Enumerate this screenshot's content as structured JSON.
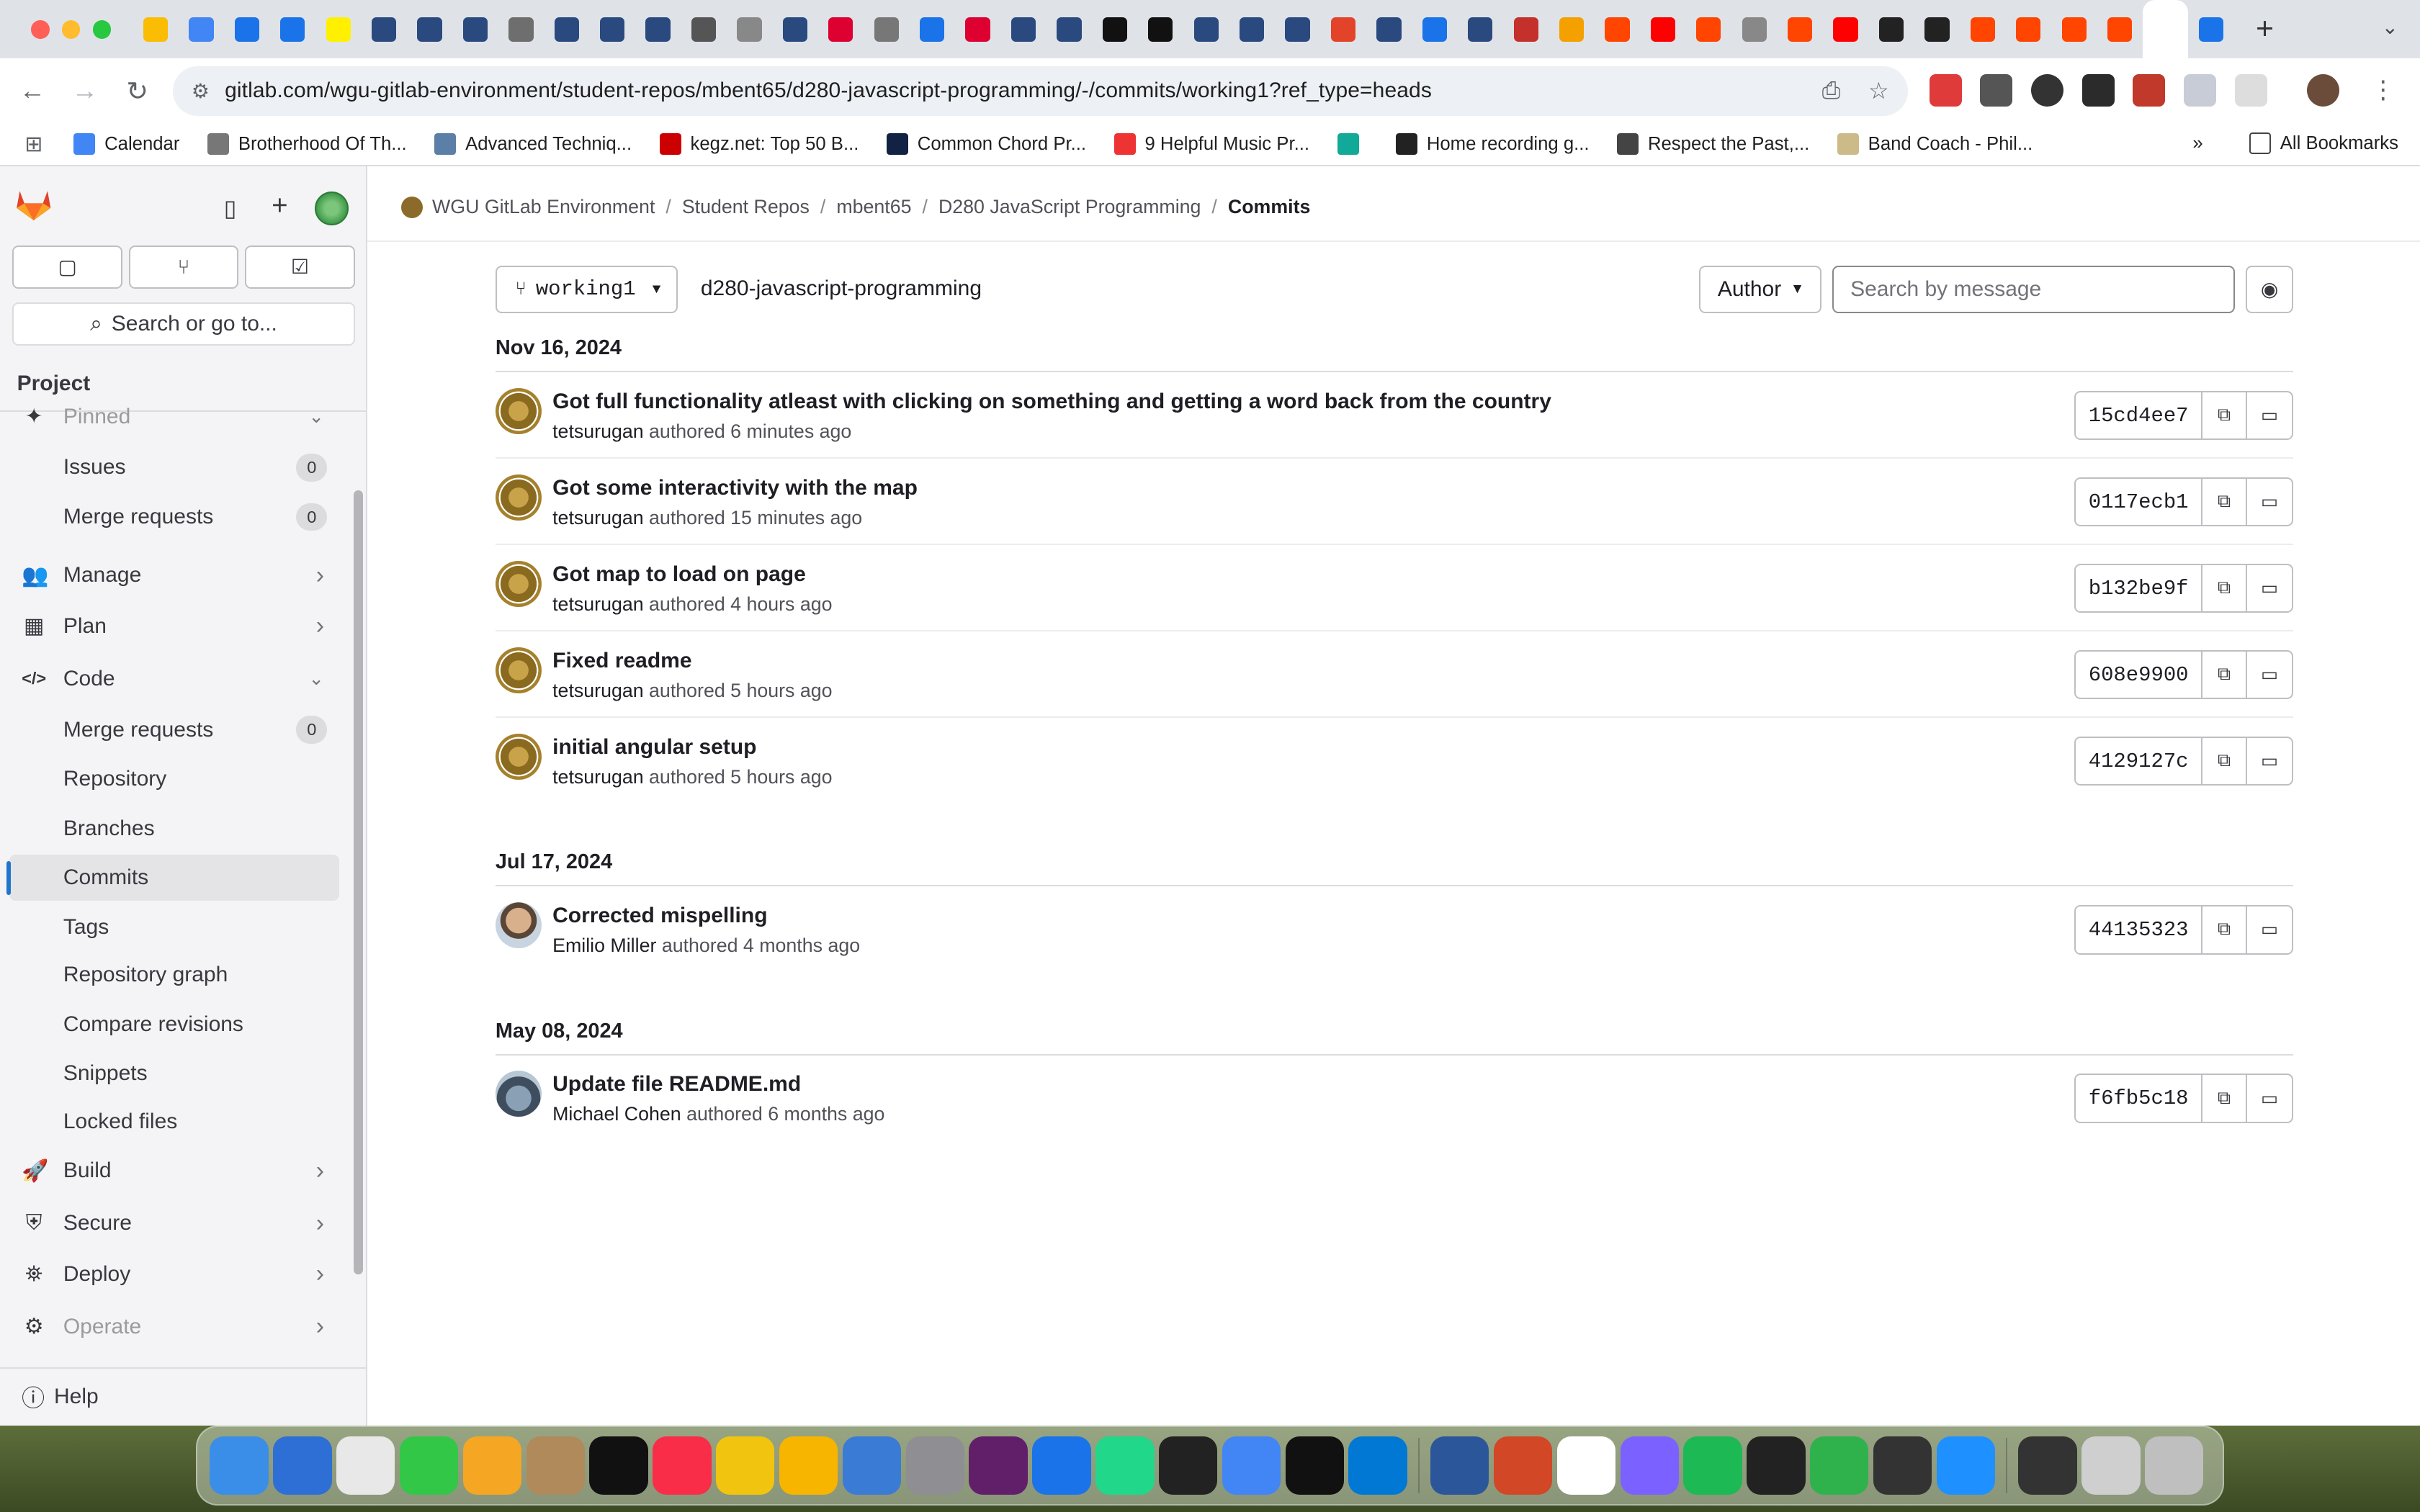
{
  "browser": {
    "url": "gitlab.com/wgu-gitlab-environment/student-repos/mbent65/d280-javascript-programming/-/commits/working1?ref_type=heads",
    "tab_favicon_colors": [
      "#fbbc04",
      "#4285f4",
      "#1a73e8",
      "#1a73e8",
      "#fef000",
      "#2a4a7f",
      "#2a4a7f",
      "#2a4a7f",
      "#6e6e6e",
      "#2a4a7f",
      "#2a4a7f",
      "#2a4a7f",
      "#555",
      "#888",
      "#2a4a7f",
      "#dd0031",
      "#777",
      "#1a73e8",
      "#dd0031",
      "#2a4a7f",
      "#2a4a7f",
      "#111",
      "#111",
      "#2a4a7f",
      "#2a4a7f",
      "#2a4a7f",
      "#e24329",
      "#2a4a7f",
      "#1a73e8",
      "#2a4a7f",
      "#c4302b",
      "#f4a100",
      "#ff4500",
      "#ff0000",
      "#ff4500",
      "#888",
      "#ff4500",
      "#ff0000",
      "#222",
      "#222",
      "#ff4500",
      "#ff4500",
      "#ff4500",
      "#ff4500",
      "#fff",
      "#1a73e8"
    ],
    "bookmarks": [
      {
        "label": "Calendar",
        "color": "#4285f4"
      },
      {
        "label": "Brotherhood Of Th...",
        "color": "#777"
      },
      {
        "label": "Advanced Techniq...",
        "color": "#5b7fa6"
      },
      {
        "label": "kegz.net: Top 50 B...",
        "color": "#c00"
      },
      {
        "label": "Common Chord Pr...",
        "color": "#124"
      },
      {
        "label": "9 Helpful Music Pr...",
        "color": "#e33"
      },
      {
        "label": "",
        "color": "#1a9"
      },
      {
        "label": "Home recording g...",
        "color": "#222"
      },
      {
        "label": "Respect the Past,...",
        "color": "#444"
      },
      {
        "label": "Band Coach - Phil...",
        "color": "#cb8"
      }
    ],
    "all_bookmarks": "All Bookmarks"
  },
  "sidebar": {
    "search": "Search or go to...",
    "section": "Project",
    "items": [
      {
        "label": "Pinned",
        "type": "top-faded"
      },
      {
        "label": "Issues",
        "badge": "0"
      },
      {
        "label": "Merge requests",
        "badge": "0"
      },
      {
        "label": "Manage",
        "type": "top"
      },
      {
        "label": "Plan",
        "type": "top"
      },
      {
        "label": "Code",
        "type": "top-open"
      },
      {
        "label": "Merge requests",
        "badge": "0"
      },
      {
        "label": "Repository"
      },
      {
        "label": "Branches"
      },
      {
        "label": "Commits",
        "active": true
      },
      {
        "label": "Tags"
      },
      {
        "label": "Repository graph"
      },
      {
        "label": "Compare revisions"
      },
      {
        "label": "Snippets"
      },
      {
        "label": "Locked files"
      },
      {
        "label": "Build",
        "type": "top"
      },
      {
        "label": "Secure",
        "type": "top"
      },
      {
        "label": "Deploy",
        "type": "top"
      },
      {
        "label": "Operate",
        "type": "top-faded"
      }
    ],
    "help": "Help"
  },
  "breadcrumb": [
    "WGU GitLab Environment",
    "Student Repos",
    "mbent65",
    "D280 JavaScript Programming",
    "Commits"
  ],
  "filters": {
    "branch": "working1",
    "path": "d280-javascript-programming",
    "author": "Author",
    "search_placeholder": "Search by message"
  },
  "commit_groups": [
    {
      "date": "Nov 16, 2024",
      "commits": [
        {
          "title": "Got full functionality atleast with clicking on something and getting a word back from the country",
          "author": "tetsurugan",
          "verb": "authored",
          "time": "6 minutes ago",
          "sha": "15cd4ee7",
          "avatar": "tet"
        },
        {
          "title": "Got some interactivity with the map",
          "author": "tetsurugan",
          "verb": "authored",
          "time": "15 minutes ago",
          "sha": "0117ecb1",
          "avatar": "tet"
        },
        {
          "title": "Got map to load on page",
          "author": "tetsurugan",
          "verb": "authored",
          "time": "4 hours ago",
          "sha": "b132be9f",
          "avatar": "tet"
        },
        {
          "title": "Fixed readme",
          "author": "tetsurugan",
          "verb": "authored",
          "time": "5 hours ago",
          "sha": "608e9900",
          "avatar": "tet"
        },
        {
          "title": "initial angular setup",
          "author": "tetsurugan",
          "verb": "authored",
          "time": "5 hours ago",
          "sha": "4129127c",
          "avatar": "tet"
        }
      ]
    },
    {
      "date": "Jul 17, 2024",
      "commits": [
        {
          "title": "Corrected mispelling",
          "author": "Emilio Miller",
          "verb": "authored",
          "time": "4 months ago",
          "sha": "44135323",
          "avatar": "emilio"
        }
      ]
    },
    {
      "date": "May 08, 2024",
      "commits": [
        {
          "title": "Update file README.md",
          "author": "Michael Cohen",
          "verb": "authored",
          "time": "6 months ago",
          "sha": "f6fb5c18",
          "avatar": "michael"
        }
      ]
    }
  ],
  "dock_colors": [
    "#3b8ee8",
    "#2e6fd6",
    "#e8e8e8",
    "#33c748",
    "#f5a623",
    "#b08a5a",
    "#111",
    "#fa2d48",
    "#f1c40f",
    "#f7b500",
    "#3a7bd5",
    "#8e8e93",
    "#611f69",
    "#1a73e8",
    "#21d789",
    "#222",
    "#4285f4",
    "#111",
    "#0078d4",
    "#2b579a",
    "#d24726",
    "#fff",
    "#7b61ff",
    "#1db954",
    "#222",
    "#2fb24c",
    "#333",
    "#1e90ff",
    "#333",
    "#cfcfcf",
    "#bfbfbf"
  ]
}
